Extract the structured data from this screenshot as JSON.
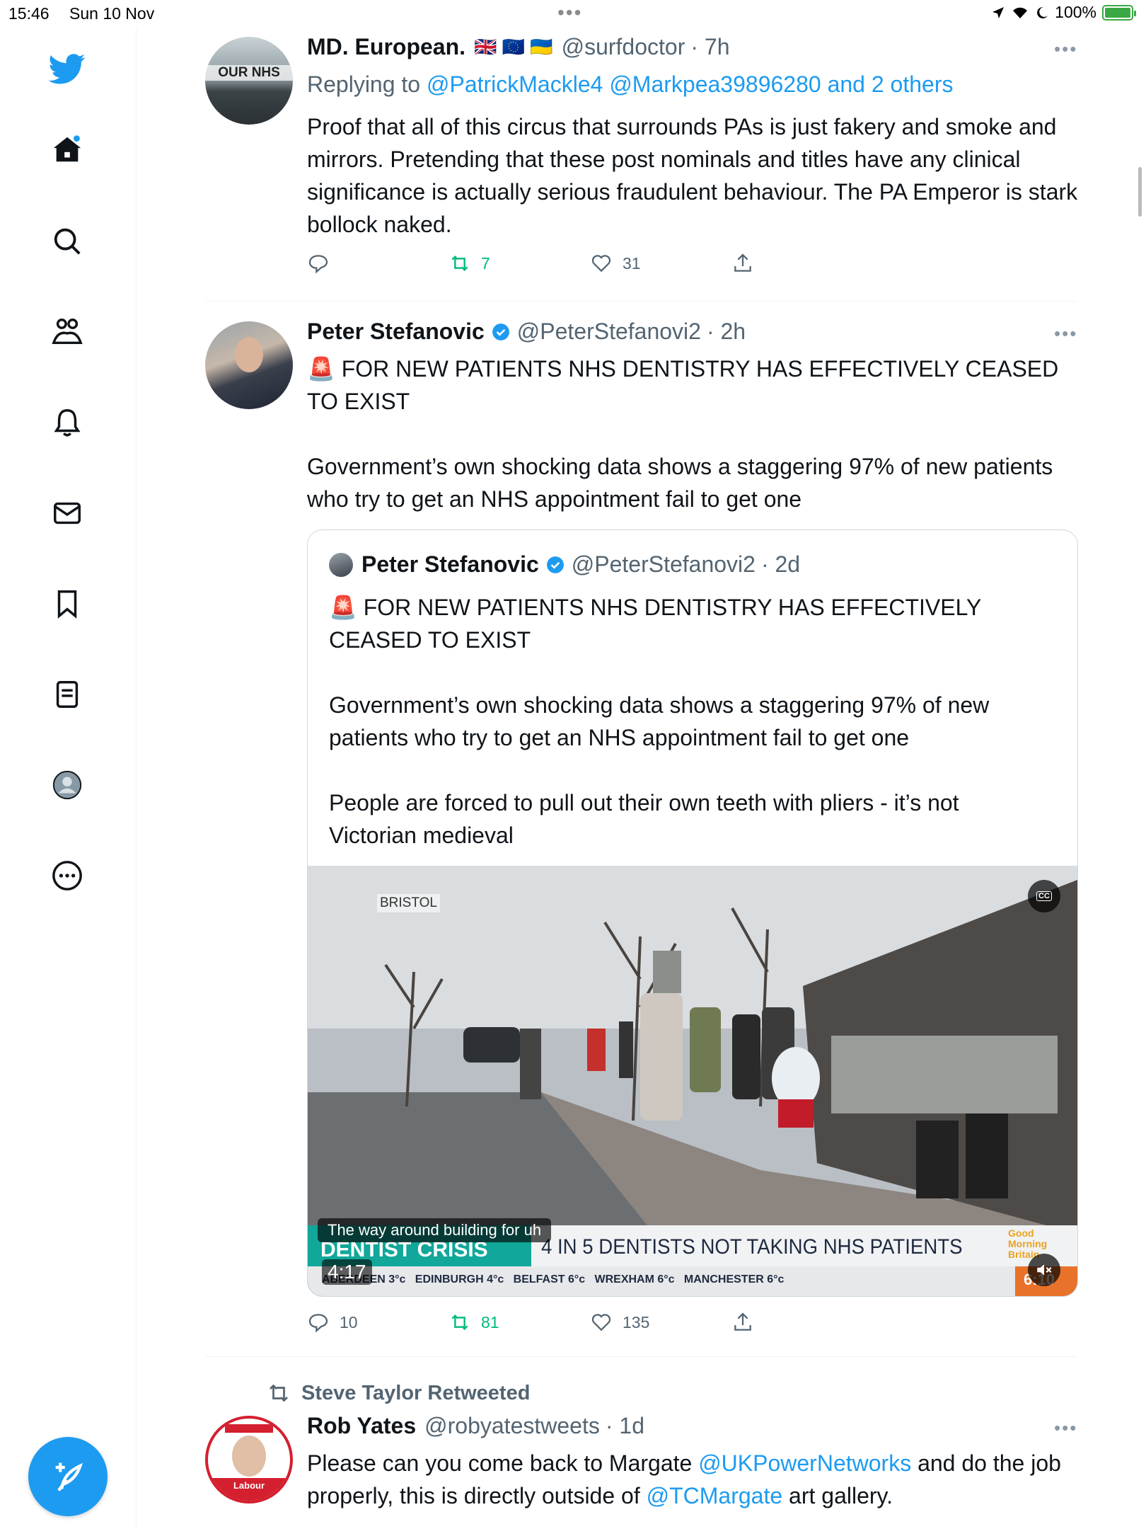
{
  "status_bar": {
    "time": "15:46",
    "date": "Sun 10 Nov",
    "battery": "100%"
  },
  "sidebar": {
    "items": [
      {
        "name": "twitter-logo"
      },
      {
        "name": "home"
      },
      {
        "name": "explore"
      },
      {
        "name": "communities"
      },
      {
        "name": "notifications"
      },
      {
        "name": "messages"
      },
      {
        "name": "bookmarks"
      },
      {
        "name": "lists"
      },
      {
        "name": "profile"
      },
      {
        "name": "more"
      }
    ],
    "compose": "compose-tweet"
  },
  "tweets": [
    {
      "name": "MD. European.",
      "flags": "🇬🇧 🇪🇺 🇺🇦",
      "handle": "@surfdoctor",
      "time": "· 7h",
      "replying_label": "Replying to",
      "replying_to": "@PatrickMackle4 @Markpea39896280 and 2 others",
      "avatar_text": "OUR NHS",
      "text": "Proof that all of this circus that surrounds PAs is just fakery and smoke and mirrors. Pretending that these post nominals and titles have any clinical significance is actually serious fraudulent behaviour. The PA Emperor is stark bollock naked.",
      "replies": "",
      "retweets": "7",
      "likes": "31"
    },
    {
      "name": "Peter Stefanovic",
      "handle": "@PeterStefanovi2",
      "time": "· 2h",
      "text": "🚨 FOR NEW PATIENTS NHS DENTISTRY HAS EFFECTIVELY CEASED TO EXIST\n\nGovernment’s own shocking data shows a staggering 97% of new patients who try to get an NHS appointment fail to get one",
      "quote": {
        "name": "Peter Stefanovic",
        "handle": "@PeterStefanovi2",
        "time": "· 2d",
        "text": "🚨 FOR NEW PATIENTS NHS DENTISTRY HAS EFFECTIVELY CEASED TO EXIST\n\nGovernment’s own shocking data shows a staggering 97% of new patients who try to get an NHS appointment fail to get one\n\nPeople are forced to pull out their own teeth with pliers - it’s not Victorian medieval",
        "video": {
          "location": "BRISTOL",
          "caption": "The way around building for uh",
          "banner_label": "DENTIST CRISIS",
          "banner_text": "4 IN 5 DENTISTS NOT TAKING NHS PATIENTS",
          "programme": "Good Morning Britain",
          "ticker": "ABERDEEN 3°c   EDINBURGH 4°c   BELFAST 6°c   WREXHAM 6°c   MANCHESTER 6°c",
          "clock": "6:10",
          "duration": "4:17",
          "cc_label": "CC"
        }
      },
      "replies": "10",
      "retweets": "81",
      "likes": "135"
    },
    {
      "retweeted_by": "Steve Taylor Retweeted",
      "name": "Rob Yates",
      "handle": "@robyatestweets",
      "time": "· 1d",
      "text_before": "Please can you come back to Margate ",
      "mention1": "@UKPowerNetworks",
      "text_middle": " and do the job properly, this is directly outside of ",
      "mention2": "@TCMargate",
      "text_after": " art gallery.",
      "avatar_text": "Labour"
    }
  ],
  "colors": {
    "accent": "#1d9bf0",
    "retweet": "#00ba7c",
    "secondary": "#536471"
  }
}
